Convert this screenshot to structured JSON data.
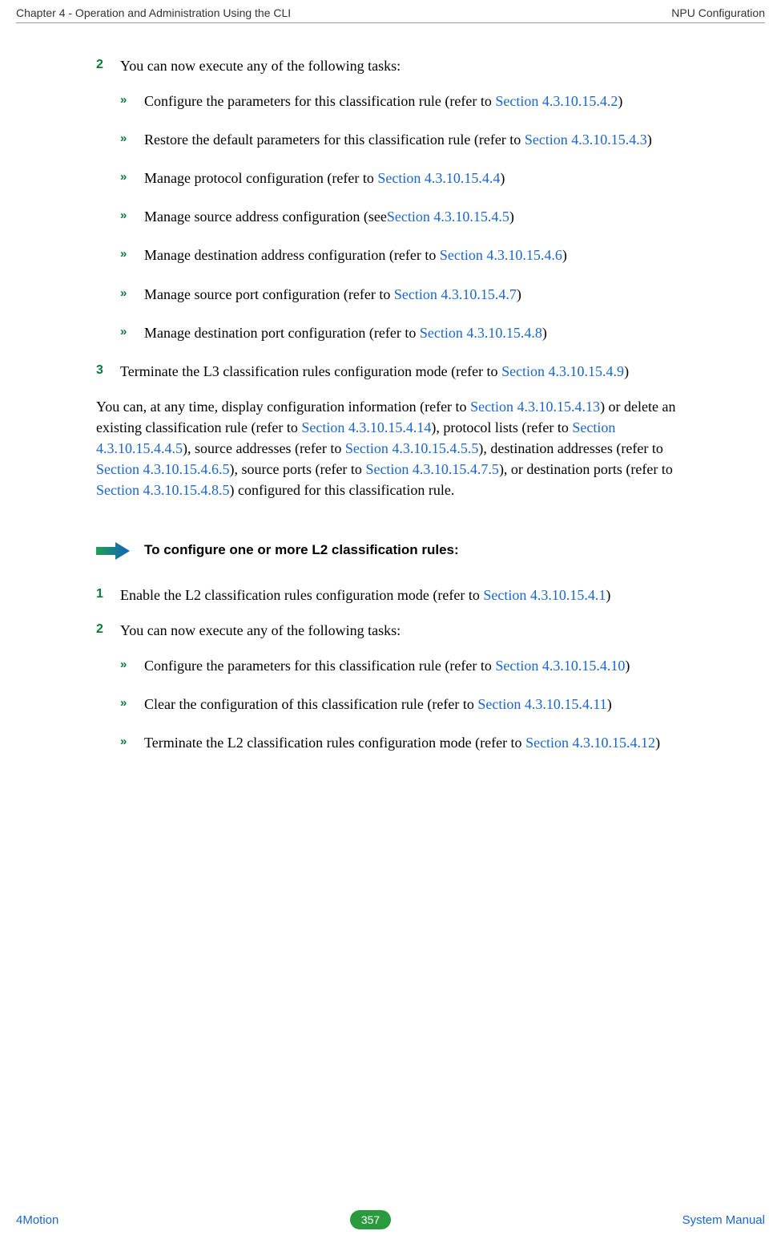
{
  "header": {
    "left": "Chapter 4 - Operation and Administration Using the CLI",
    "right": "NPU Configuration"
  },
  "body": {
    "step2": {
      "num": "2",
      "text": "You can now execute any of the following tasks:"
    },
    "sub2": [
      {
        "pre": "Configure the parameters for this classification rule (refer to ",
        "link": "Section 4.3.10.15.4.2",
        "post": ")"
      },
      {
        "pre": "Restore the default parameters for this classification rule (refer to ",
        "link": "Section 4.3.10.15.4.3",
        "post": ")"
      },
      {
        "pre": "Manage protocol configuration (refer to ",
        "link": "Section 4.3.10.15.4.4",
        "post": ")"
      },
      {
        "pre": "Manage source address configuration (see",
        "link": "Section 4.3.10.15.4.5",
        "post": ")"
      },
      {
        "pre": "Manage destination address configuration (refer to ",
        "link": "Section 4.3.10.15.4.6",
        "post": ")"
      },
      {
        "pre": "Manage source port configuration (refer to ",
        "link": "Section 4.3.10.15.4.7",
        "post": ")"
      },
      {
        "pre": "Manage destination port configuration (refer to ",
        "link": "Section 4.3.10.15.4.8",
        "post": ")"
      }
    ],
    "step3": {
      "num": "3",
      "pre": "Terminate the L3 classification rules configuration mode (refer to ",
      "link": "Section 4.3.10.15.4.9",
      "post": ")"
    },
    "para": {
      "seg1": "You can, at any time, display configuration information (refer to ",
      "l1": "Section 4.3.10.15.4.13",
      "seg2": ") or delete an existing classification rule (refer to ",
      "l2": "Section 4.3.10.15.4.14",
      "seg3": "), protocol lists (refer to ",
      "l3": "Section 4.3.10.15.4.4.5",
      "seg4": "), source addresses (refer to ",
      "l4": "Section 4.3.10.15.4.5.5",
      "seg5": "), destination addresses (refer to ",
      "l5": "Section 4.3.10.15.4.6.5",
      "seg6": "), source ports (refer to ",
      "l6": "Section 4.3.10.15.4.7.5",
      "seg7": "), or destination ports (refer to ",
      "l7": "Section 4.3.10.15.4.8.5",
      "seg8": ") configured for this classification rule."
    },
    "callout": "To configure one or more L2 classification rules:",
    "stepB1": {
      "num": "1",
      "pre": "Enable the L2 classification rules configuration mode (refer to ",
      "link": "Section 4.3.10.15.4.1",
      "post": ")"
    },
    "stepB2": {
      "num": "2",
      "text": "You can now execute any of the following tasks:"
    },
    "subB2": [
      {
        "pre": "Configure the parameters for this classification rule (refer to ",
        "link": "Section 4.3.10.15.4.10",
        "post": ")"
      },
      {
        "pre": "Clear the configuration of this classification rule (refer to ",
        "link": "Section 4.3.10.15.4.11",
        "post": ")"
      },
      {
        "pre": "Terminate the L2 classification rules configuration mode (refer to ",
        "link": "Section 4.3.10.15.4.12",
        "post": ")"
      }
    ]
  },
  "footer": {
    "left": "4Motion",
    "page": "357",
    "right": "System Manual"
  },
  "bullet_glyph": "»"
}
